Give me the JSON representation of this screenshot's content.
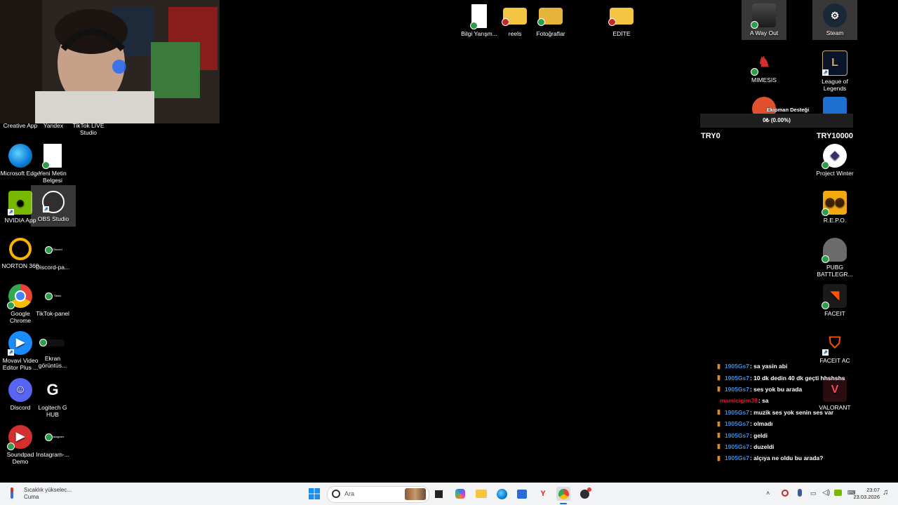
{
  "desktop": {
    "top_icons": [
      {
        "label": "Bilgi Yarışm...",
        "icon": "document-icon"
      },
      {
        "label": "reels",
        "icon": "folder-icon"
      },
      {
        "label": "Fotoğraflar",
        "icon": "folder-icon"
      },
      {
        "label": "EDİTE",
        "icon": "folder-icon"
      }
    ],
    "left_icons": [
      {
        "label": "Creative App"
      },
      {
        "label": "Yandex"
      },
      {
        "label": "TikTok LIVE Studio"
      },
      {
        "label": "Microsoft Edge"
      },
      {
        "label": "Yeni Metin Belgesi"
      },
      {
        "label": "NVIDIA App"
      },
      {
        "label": "OBS Studio"
      },
      {
        "label": "NORTON 360"
      },
      {
        "label": "Discord-pa..."
      },
      {
        "label": "Google Chrome"
      },
      {
        "label": "TikTok-panel"
      },
      {
        "label": "Movavi Video Editor Plus ..."
      },
      {
        "label": "Ekran görüntüs..."
      },
      {
        "label": "Discord"
      },
      {
        "label": "Logitech G HUB"
      },
      {
        "label": "Soundpad Demo"
      },
      {
        "label": "Instagram-..."
      }
    ],
    "right_icons": [
      {
        "label": "A Way Out"
      },
      {
        "label": "Steam"
      },
      {
        "label": "MIMESIS"
      },
      {
        "label": "League of Legends"
      },
      {
        "label": "Project Winter"
      },
      {
        "label": "R.E.P.O."
      },
      {
        "label": "PUBG BATTLEGR..."
      },
      {
        "label": "FACEIT"
      },
      {
        "label": "FACEIT AC"
      },
      {
        "label": "VALORANT"
      }
    ],
    "mini_labels": {
      "discord_panel": "Discord",
      "tiktok_panel": "Tiktok",
      "instagram_panel": "Instagram"
    }
  },
  "donation_goal": {
    "title": "Ekipman Desteği",
    "progress_text": "0₺ (0.00%)",
    "progress": 0,
    "min_label": "TRY0",
    "max_label": "TRY10000"
  },
  "chat": {
    "messages": [
      {
        "user": "1905Gs7",
        "text": ": sa yasin abi",
        "color": "blue"
      },
      {
        "user": "1905Gs7",
        "text": ": 10 dk dedin 40 dk geçti hhshshs",
        "color": "blue"
      },
      {
        "user": "1905Gs7",
        "text": ": ses yok bu arada",
        "color": "blue"
      },
      {
        "user": "mamicigim38",
        "text": ": sa",
        "color": "red"
      },
      {
        "user": "1905Gs7",
        "text": ": muzik ses yok senin ses var",
        "color": "blue"
      },
      {
        "user": "1905Gs7",
        "text": ": olmadı",
        "color": "blue"
      },
      {
        "user": "1905Gs7",
        "text": ": geldi",
        "color": "blue"
      },
      {
        "user": "1905Gs7",
        "text": ": duzeldi",
        "color": "blue"
      },
      {
        "user": "1905Gs7",
        "text": ": alçıya ne oldu bu arada?",
        "color": "blue"
      }
    ]
  },
  "taskbar": {
    "weather_title": "Sıcaklık yükselec...",
    "weather_sub": "Cuma",
    "search_placeholder": "Ara",
    "time": "23:07",
    "date": "23.03.2026"
  },
  "colors": {
    "chat_user": "#3b8ee6",
    "chat_user_alt": "#d81b2c",
    "chat_marker": "#e08a1e",
    "taskbar_bg": "#f1f3f5"
  }
}
